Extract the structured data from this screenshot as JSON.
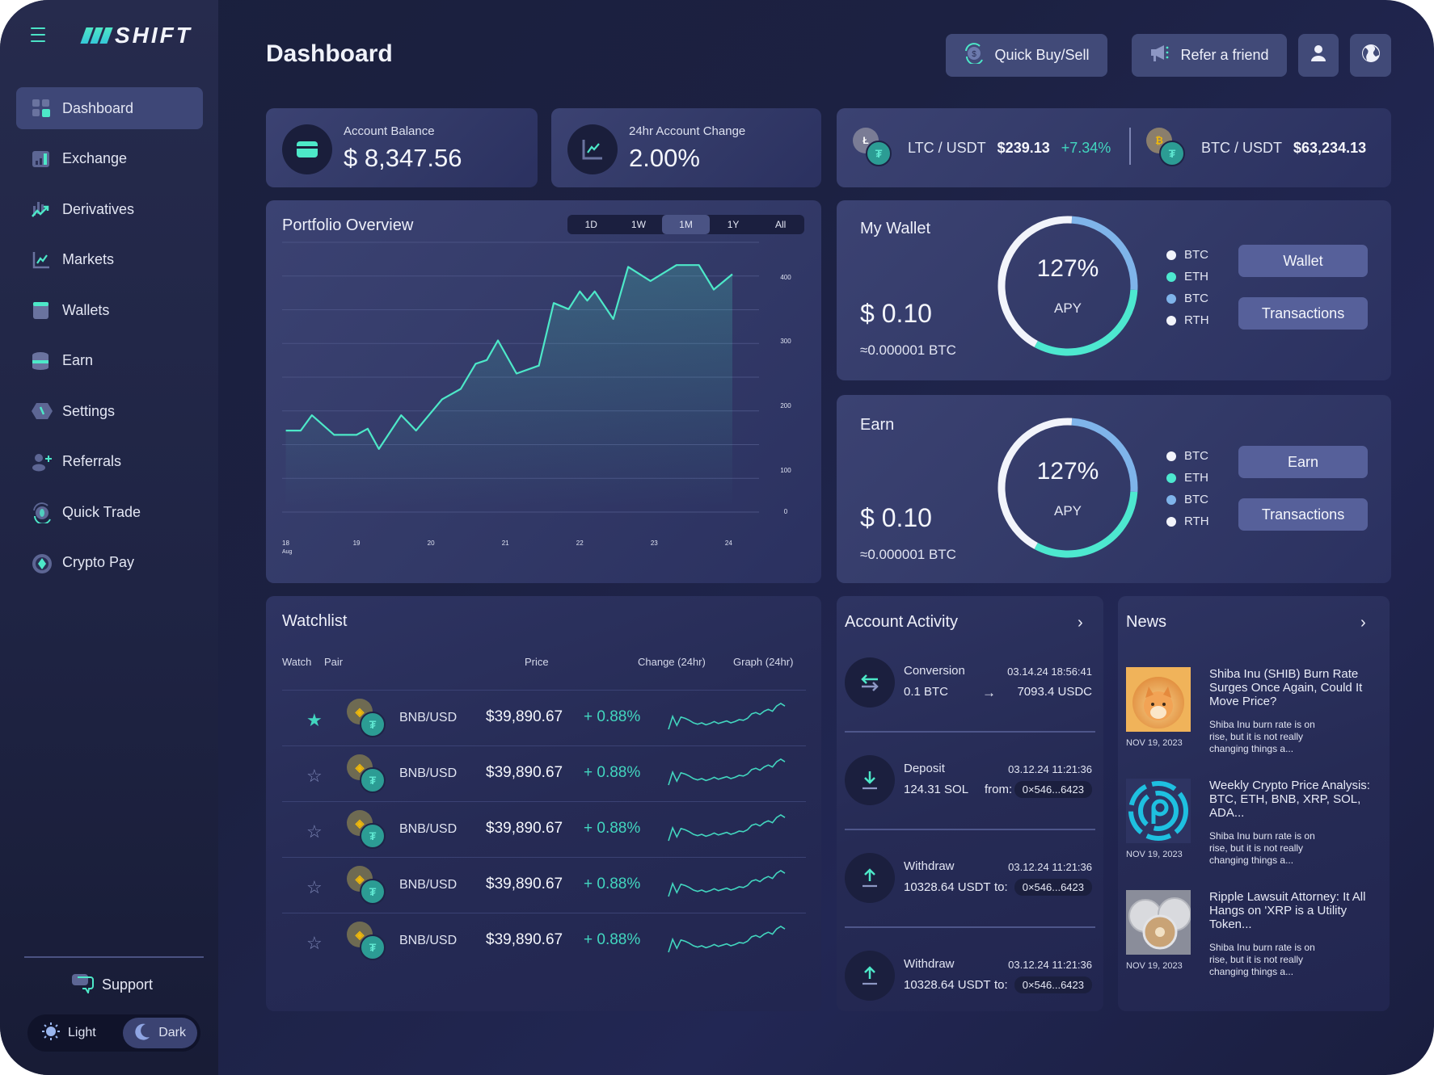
{
  "sidebar": {
    "logo": "SHIFT",
    "items": [
      {
        "label": "Dashboard",
        "icon": "dashboard-icon",
        "active": true
      },
      {
        "label": "Exchange",
        "icon": "exchange-icon"
      },
      {
        "label": "Derivatives",
        "icon": "derivatives-icon"
      },
      {
        "label": "Markets",
        "icon": "markets-icon"
      },
      {
        "label": "Wallets",
        "icon": "wallets-icon"
      },
      {
        "label": "Earn",
        "icon": "earn-icon"
      },
      {
        "label": "Settings",
        "icon": "settings-icon"
      },
      {
        "label": "Referrals",
        "icon": "referrals-icon"
      },
      {
        "label": "Quick Trade",
        "icon": "quick-trade-icon"
      },
      {
        "label": "Crypto Pay",
        "icon": "crypto-pay-icon"
      }
    ],
    "support_label": "Support",
    "theme": {
      "light_label": "Light",
      "dark_label": "Dark",
      "selected": "Dark"
    }
  },
  "header": {
    "title": "Dashboard",
    "quick_buy_sell_label": "Quick Buy/Sell",
    "refer_label": "Refer a friend",
    "user_icon": "user-icon",
    "globe_icon": "globe-icon"
  },
  "stats": {
    "balance": {
      "label": "Account Balance",
      "value": "$ 8,347.56"
    },
    "change": {
      "label": "24hr Account Change",
      "value": "2.00%"
    }
  },
  "tickers": [
    {
      "base_symbol": "Ł",
      "pair": "LTC / USDT",
      "price": "$239.13",
      "change": "+7.34%"
    },
    {
      "base_symbol": "₿",
      "pair": "BTC / USDT",
      "price": "$63,234.13",
      "change": ""
    }
  ],
  "portfolio": {
    "title": "Portfolio Overview",
    "ranges": [
      "1D",
      "1W",
      "1M",
      "1Y",
      "All"
    ],
    "selected_range": "1M"
  },
  "chart_data": {
    "type": "area",
    "title": "Portfolio Overview",
    "xlabel": "",
    "ylabel": "",
    "x_ticks": [
      "18\nAug",
      "19",
      "20",
      "21",
      "22",
      "23",
      "24"
    ],
    "y_ticks": [
      0,
      100,
      200,
      300,
      400
    ],
    "ylim": [
      0,
      440
    ],
    "xlim": [
      18,
      24.3
    ],
    "grid": true,
    "color": "#4de8c8",
    "series": [
      {
        "name": "Portfolio",
        "x": [
          18.05,
          18.25,
          18.4,
          18.7,
          19.0,
          19.15,
          19.3,
          19.6,
          19.8,
          20.15,
          20.4,
          20.6,
          20.75,
          20.9,
          21.15,
          21.45,
          21.65,
          21.85,
          22.0,
          22.1,
          22.2,
          22.45,
          22.65,
          22.95,
          23.3,
          23.6,
          23.8,
          24.05
        ],
        "values": [
          125,
          125,
          150,
          118,
          118,
          128,
          95,
          150,
          125,
          176,
          193,
          234,
          240,
          272,
          218,
          231,
          333,
          323,
          352,
          337,
          352,
          307,
          392,
          369,
          395,
          395,
          355,
          380
        ]
      }
    ]
  },
  "wallet": {
    "title": "My Wallet",
    "amount": "$ 0.10",
    "btc": "≈0.000001 BTC",
    "apy_value": "127%",
    "apy_label": "APY",
    "segments": [
      {
        "label": "BTC",
        "color": "#f2f4fb",
        "share": 0.43
      },
      {
        "label": "ETH",
        "color": "#4de8cf",
        "share": 0.32
      },
      {
        "label": "BTC",
        "color": "#7fb4ea",
        "share": 0.25
      },
      {
        "label": "RTH",
        "color": "#f2f4fb",
        "share": 0
      }
    ],
    "legend": [
      {
        "label": "BTC",
        "color": "#f2f4fb"
      },
      {
        "label": "ETH",
        "color": "#4de8cf"
      },
      {
        "label": "BTC",
        "color": "#7fb4ea"
      },
      {
        "label": "RTH",
        "color": "#f2f4fb"
      }
    ],
    "button_primary": "Wallet",
    "button_secondary": "Transactions"
  },
  "earn": {
    "title": "Earn",
    "amount": "$ 0.10",
    "btc": "≈0.000001 BTC",
    "apy_value": "127%",
    "apy_label": "APY",
    "legend": [
      {
        "label": "BTC",
        "color": "#f2f4fb"
      },
      {
        "label": "ETH",
        "color": "#4de8cf"
      },
      {
        "label": "BTC",
        "color": "#7fb4ea"
      },
      {
        "label": "RTH",
        "color": "#f2f4fb"
      }
    ],
    "button_primary": "Earn",
    "button_secondary": "Transactions"
  },
  "watchlist": {
    "title": "Watchlist",
    "columns": [
      "Watch",
      "Pair",
      "Price",
      "Change (24hr)",
      "Graph (24hr)"
    ],
    "rows": [
      {
        "watched": true,
        "pair": "BNB/USD",
        "price": "$39,890.67",
        "change": "+ 0.88%"
      },
      {
        "watched": false,
        "pair": "BNB/USD",
        "price": "$39,890.67",
        "change": "+ 0.88%"
      },
      {
        "watched": false,
        "pair": "BNB/USD",
        "price": "$39,890.67",
        "change": "+ 0.88%"
      },
      {
        "watched": false,
        "pair": "BNB/USD",
        "price": "$39,890.67",
        "change": "+ 0.88%"
      },
      {
        "watched": false,
        "pair": "BNB/USD",
        "price": "$39,890.67",
        "change": "+ 0.88%"
      }
    ]
  },
  "activity": {
    "title": "Account Activity",
    "items": [
      {
        "type": "Conversion",
        "time": "03.14.24 18:56:41",
        "amount": "0.1 BTC",
        "middle": "→",
        "right": "7093.4 USDC",
        "icon": "conversion-icon"
      },
      {
        "type": "Deposit",
        "time": "03.12.24 11:21:36",
        "amount": "124.31 SOL",
        "middle": "from:",
        "right": "0×546...6423",
        "icon": "deposit-icon"
      },
      {
        "type": "Withdraw",
        "time": "03.12.24 11:21:36",
        "amount": "10328.64 USDT",
        "middle": "to:",
        "right": "0×546...6423",
        "icon": "withdraw-icon"
      },
      {
        "type": "Withdraw",
        "time": "03.12.24 11:21:36",
        "amount": "10328.64 USDT",
        "middle": "to:",
        "right": "0×546...6423",
        "icon": "withdraw-icon"
      }
    ]
  },
  "news": {
    "title": "News",
    "items": [
      {
        "title": "Shiba Inu (SHIB) Burn Rate Surges Once Again, Could It Move Price?",
        "desc": "Shiba Inu burn rate is on rise, but it is not really changing things a...",
        "date": "NOV 19, 2023",
        "image": "shiba-inu-image"
      },
      {
        "title": "Weekly Crypto Price Analysis: BTC, ETH, BNB, XRP, SOL, ADA...",
        "desc": "Shiba Inu burn rate is on rise, but it is not really changing things a...",
        "date": "NOV 19, 2023",
        "image": "crypto-logo-image"
      },
      {
        "title": "Ripple Lawsuit Attorney: It All Hangs on 'XRP is a Utility Token...",
        "desc": "Shiba Inu burn rate is on rise, but it is not really changing things a...",
        "date": "NOV 19, 2023",
        "image": "ripple-coins-image"
      }
    ]
  },
  "colors": {
    "accent": "#4de8c8",
    "positive": "#42d6bf",
    "card": "#363d6c",
    "background": "#1c2142"
  }
}
